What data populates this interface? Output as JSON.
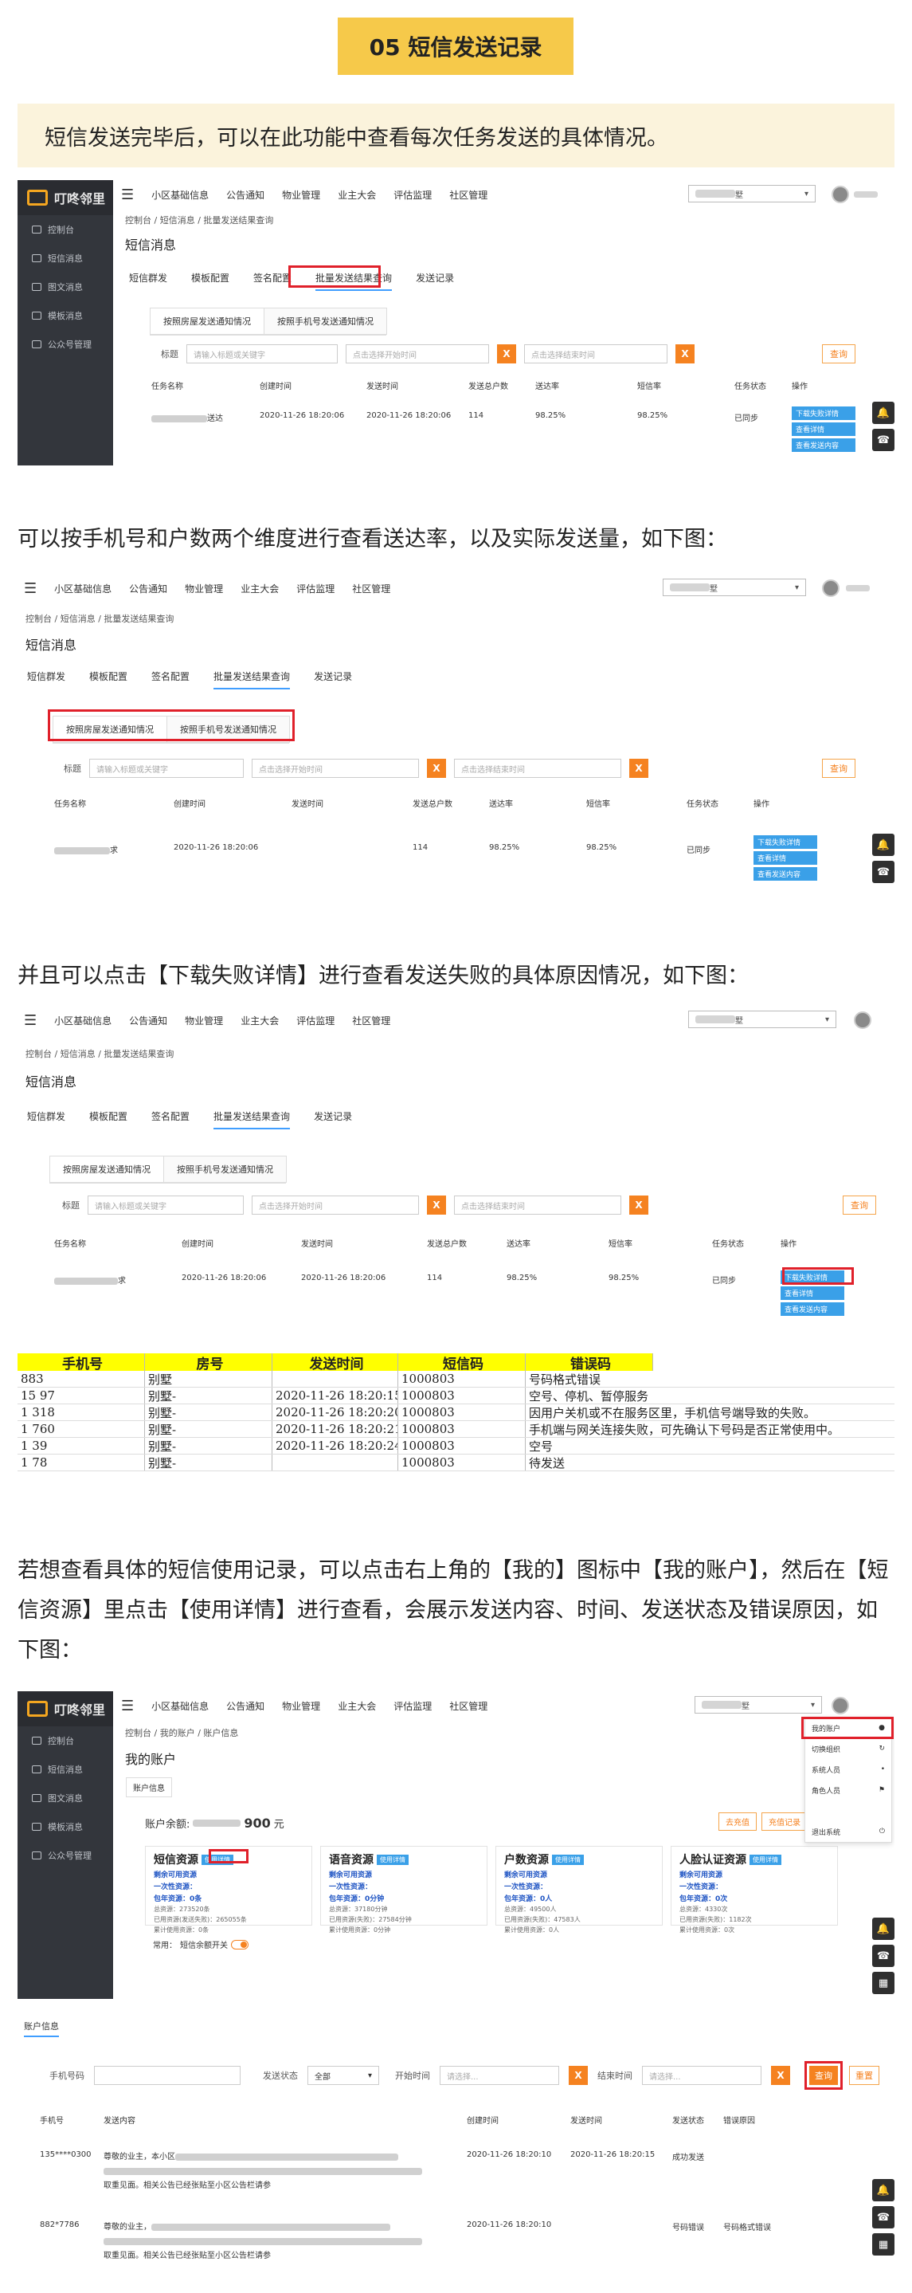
{
  "section_title": "05 短信发送记录",
  "intro": "短信发送完毕后，可以在此功能中查看每次任务发送的具体情况。",
  "para2": "可以按手机号和户数两个维度进行查看送达率，以及实际发送量，如下图：",
  "para3": "并且可以点击【下载失败详情】进行查看发送失败的具体原因情况，如下图：",
  "para4": "若想查看具体的短信使用记录，可以点击右上角的【我的】图标中【我的账户】，然后在【短信资源】里点击【使用详情】进行查看，会展示发送内容、时间、发送状态及错误原因，如下图：",
  "app": {
    "brand": "叮咚邻里",
    "sidebar": [
      "控制台",
      "短信消息",
      "图文消息",
      "模板消息",
      "公众号管理"
    ],
    "nav": [
      "小区基础信息",
      "公告通知",
      "物业管理",
      "业主大会",
      "评估监理",
      "社区管理"
    ],
    "account_suffix": "墅",
    "caret": "▾",
    "crumb": "控制台  /  短信消息  /  批量发送结果查询",
    "page_title": "短信消息",
    "tabs": [
      "短信群发",
      "模板配置",
      "签名配置",
      "批量发送结果查询",
      "发送记录"
    ],
    "subtabs": [
      "按照房屋发送通知情况",
      "按照手机号发送通知情况"
    ],
    "filter_label": "标题",
    "filter_placeholder": "请输入标题或关键字",
    "start_placeholder": "点击选择开始时间",
    "end_placeholder": "点击选择结束时间",
    "x": "X",
    "query": "查询",
    "columns": [
      "任务名称",
      "创建时间",
      "发送时间",
      "发送总户数",
      "送达率",
      "短信率",
      "任务状态",
      "操作"
    ],
    "row": {
      "name_suffix": "送达",
      "name_suffix2": "求",
      "created": "2020-11-26 18:20:06",
      "sent": "2020-11-26 18:20:06",
      "households": "114",
      "rate1": "98.25%",
      "rate2": "98.25%",
      "status": "已同步"
    },
    "ops": [
      "下载失败详情",
      "查看详情",
      "查看发送内容"
    ]
  },
  "sheet": {
    "headers": [
      "手机号",
      "房号",
      "发送时间",
      "短信码",
      "错误码"
    ],
    "rows": [
      [
        "883",
        "别墅",
        "",
        "1000803",
        "号码格式错误"
      ],
      [
        "15        97",
        "别墅-",
        "2020-11-26 18:20:15",
        "1000803",
        "空号、停机、暂停服务"
      ],
      [
        "1         318",
        "别墅-",
        "2020-11-26 18:20:20",
        "1000803",
        "因用户关机或不在服务区里，手机信号端导致的失败。"
      ],
      [
        "1         760",
        "别墅-",
        "2020-11-26 18:20:21",
        "1000803",
        "手机端与网关连接失败，可先确认下号码是否正常使用中。"
      ],
      [
        "1         39",
        "别墅-",
        "2020-11-26 18:20:24",
        "1000803",
        "空号"
      ],
      [
        "1         78",
        "别墅-",
        "",
        "1000803",
        "待发送"
      ]
    ]
  },
  "acct": {
    "crumb": "控制台  /  我的账户  /  账户信息",
    "title": "我的账户",
    "tab": "账户信息",
    "balance_label": "账户余额:",
    "balance_value": "900",
    "balance_unit": "元",
    "btn_recharge": "去充值",
    "btn_record": "充值记录",
    "cards": [
      {
        "title": "短信资源",
        "badge": "使用详情",
        "l1": "剩余可用资源",
        "l2": "一次性资源：",
        "l3": "包年资源：0条",
        "s1": "总资源：273520条",
        "s2": "已用资源(发送失败)：265055条",
        "s3": "累计使用资源：0条"
      },
      {
        "title": "语音资源",
        "badge": "使用详情",
        "l1": "剩余可用资源",
        "l2": "一次性资源：",
        "l3": "包年资源：0分钟",
        "s1": "总资源：37180分钟",
        "s2": "已用资源(失败)：27584分钟",
        "s3": "累计使用资源：0分钟"
      },
      {
        "title": "户数资源",
        "badge": "使用详情",
        "l1": "剩余可用资源",
        "l2": "一次性资源：",
        "l3": "包年资源：0人",
        "s1": "总资源：49500人",
        "s2": "已用资源(失败)：47583人",
        "s3": "累计使用资源：0人"
      },
      {
        "title": "人脸认证资源",
        "badge": "使用详情",
        "l1": "剩余可用资源",
        "l2": "一次性资源：",
        "l3": "包年资源：0次",
        "s1": "总资源：4330次",
        "s2": "已用资源(失败)：1182次",
        "s3": "累计使用资源：0次"
      }
    ],
    "common_label": "常用：",
    "common_text": "短信余额开关",
    "menu": [
      "我的账户",
      "切换组织",
      "系统人员",
      "角色人员",
      "",
      "退出系统"
    ],
    "section": "账户信息",
    "f_phone": "手机号码",
    "f_status": "发送状态",
    "f_status_val": "全部",
    "f_start": "开始时间",
    "f_start_ph": "请选择...",
    "f_end": "结束时间",
    "f_end_ph": "请选择...",
    "btn_query": "查询",
    "btn_reset": "重置",
    "cols": [
      "手机号",
      "发送内容",
      "创建时间",
      "发送时间",
      "发送状态",
      "错误原因"
    ],
    "rows": [
      {
        "phone": "135****0300",
        "c1": "尊敬的业主，本小区",
        "c2": "取重见面。相关公告已经张贴至小区公告栏请参",
        "created": "2020-11-26 18:20:10",
        "sent": "2020-11-26 18:20:15",
        "status": "成功发送",
        "err": ""
      },
      {
        "phone": "882*7786",
        "c1": "尊敬的业主，",
        "c2": "取重见面。相关公告已经张贴至小区公告栏请参",
        "created": "2020-11-26 18:20:10",
        "sent": "",
        "status": "号码错误",
        "err": "号码格式错误"
      }
    ]
  }
}
